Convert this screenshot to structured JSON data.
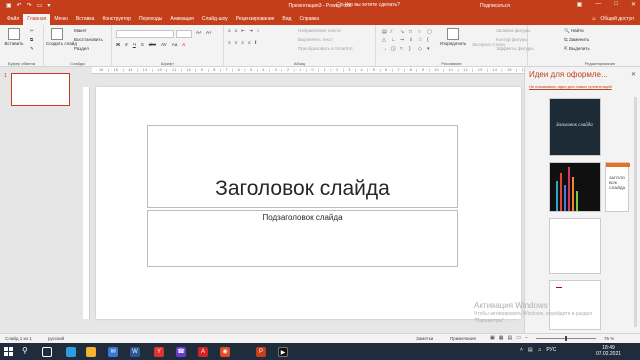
{
  "window": {
    "title": "Презентация3 - PowerPoint",
    "search_placeholder": "Что вы хотите сделать?",
    "user_label": "Подписаться",
    "accent_color": "#c43e1c"
  },
  "quick_access": [
    "save-icon",
    "undo-icon",
    "redo-icon",
    "present-icon",
    "customize-icon"
  ],
  "tabs": [
    {
      "label": "Файл"
    },
    {
      "label": "Главная",
      "active": true
    },
    {
      "label": "Меню"
    },
    {
      "label": "Вставка"
    },
    {
      "label": "Конструктор"
    },
    {
      "label": "Переходы"
    },
    {
      "label": "Анимация"
    },
    {
      "label": "Слайд-шоу"
    },
    {
      "label": "Рецензирование"
    },
    {
      "label": "Вид"
    },
    {
      "label": "Справка"
    }
  ],
  "tab_search": "Что вы хотите сделать?",
  "share_label": "Общий доступ",
  "ribbon": {
    "clipboard": {
      "label": "Буфер обмена",
      "paste": "Вставить"
    },
    "slides": {
      "label": "Слайды",
      "new_slide": "Создать слайд",
      "layout": "Макет",
      "reset": "Восстановить",
      "section": "Раздел"
    },
    "font": {
      "label": "Шрифт"
    },
    "paragraph": {
      "label": "Абзац",
      "text_direction": "Направление текста",
      "align_text": "Выровнять текст",
      "smartart": "Преобразовать в SmartArt"
    },
    "drawing": {
      "label": "Рисование",
      "arrange": "Упорядочить",
      "quick_styles": "Экспресс-стили",
      "fill": "Заливка фигуры",
      "outline": "Контур фигуры",
      "effects": "Эффекты фигуры"
    },
    "editing": {
      "label": "Редактирование",
      "find": "Найти",
      "replace": "Заменить",
      "select": "Выделить"
    }
  },
  "ruler_text": "· 16 · | · 15 · | · 14 · | · 13 · | · 12 · | · 11 · | · 10 · | · 9 · | · 8 · | · 7 · | · 6 · | · 5 · | · 4 · | · 3 · | · 2 · | · 1 · | · 0 · | · 1 · | · 2 · | · 3 · | · 4 · | · 5 · | · 6 · | · 7 · | · 8 · | · 9 · | · 10 · | · 11 · | · 12 · | · 13 · | · 14 · | · 15 · | · 16 ·",
  "thumbnail": {
    "number": "1"
  },
  "slide": {
    "title": "Заголовок слайда",
    "subtitle": "Подзаголовок слайда"
  },
  "designer": {
    "title": "Идеи для оформле...",
    "link": "Не показывать идеи для новых презентаций",
    "card1_text": "Заголовок слайда",
    "card3_text": "ЗАГОЛО\nВОК\nСЛАЙДА"
  },
  "watermark": {
    "line1": "Активация Windows",
    "line2": "Чтобы активировать Windows, перейдите в раздел",
    "line3": "\"Параметры\"."
  },
  "statusbar": {
    "slide_info": "Слайд 1 из 1",
    "language": "русский",
    "notes": "Заметки",
    "comments": "Примечания",
    "zoom": "76 %"
  },
  "taskbar": {
    "apps": [
      "search-icon",
      "task-view-icon",
      "explorer-icon",
      "mail-icon",
      "store-icon",
      "word-icon",
      "yandex-icon",
      "photoshop-icon",
      "acrobat-icon",
      "chrome-icon",
      "powerpoint-icon",
      "media-icon"
    ],
    "tray_lang": "РУС",
    "time": "18:49",
    "date": "07.02.2021"
  }
}
